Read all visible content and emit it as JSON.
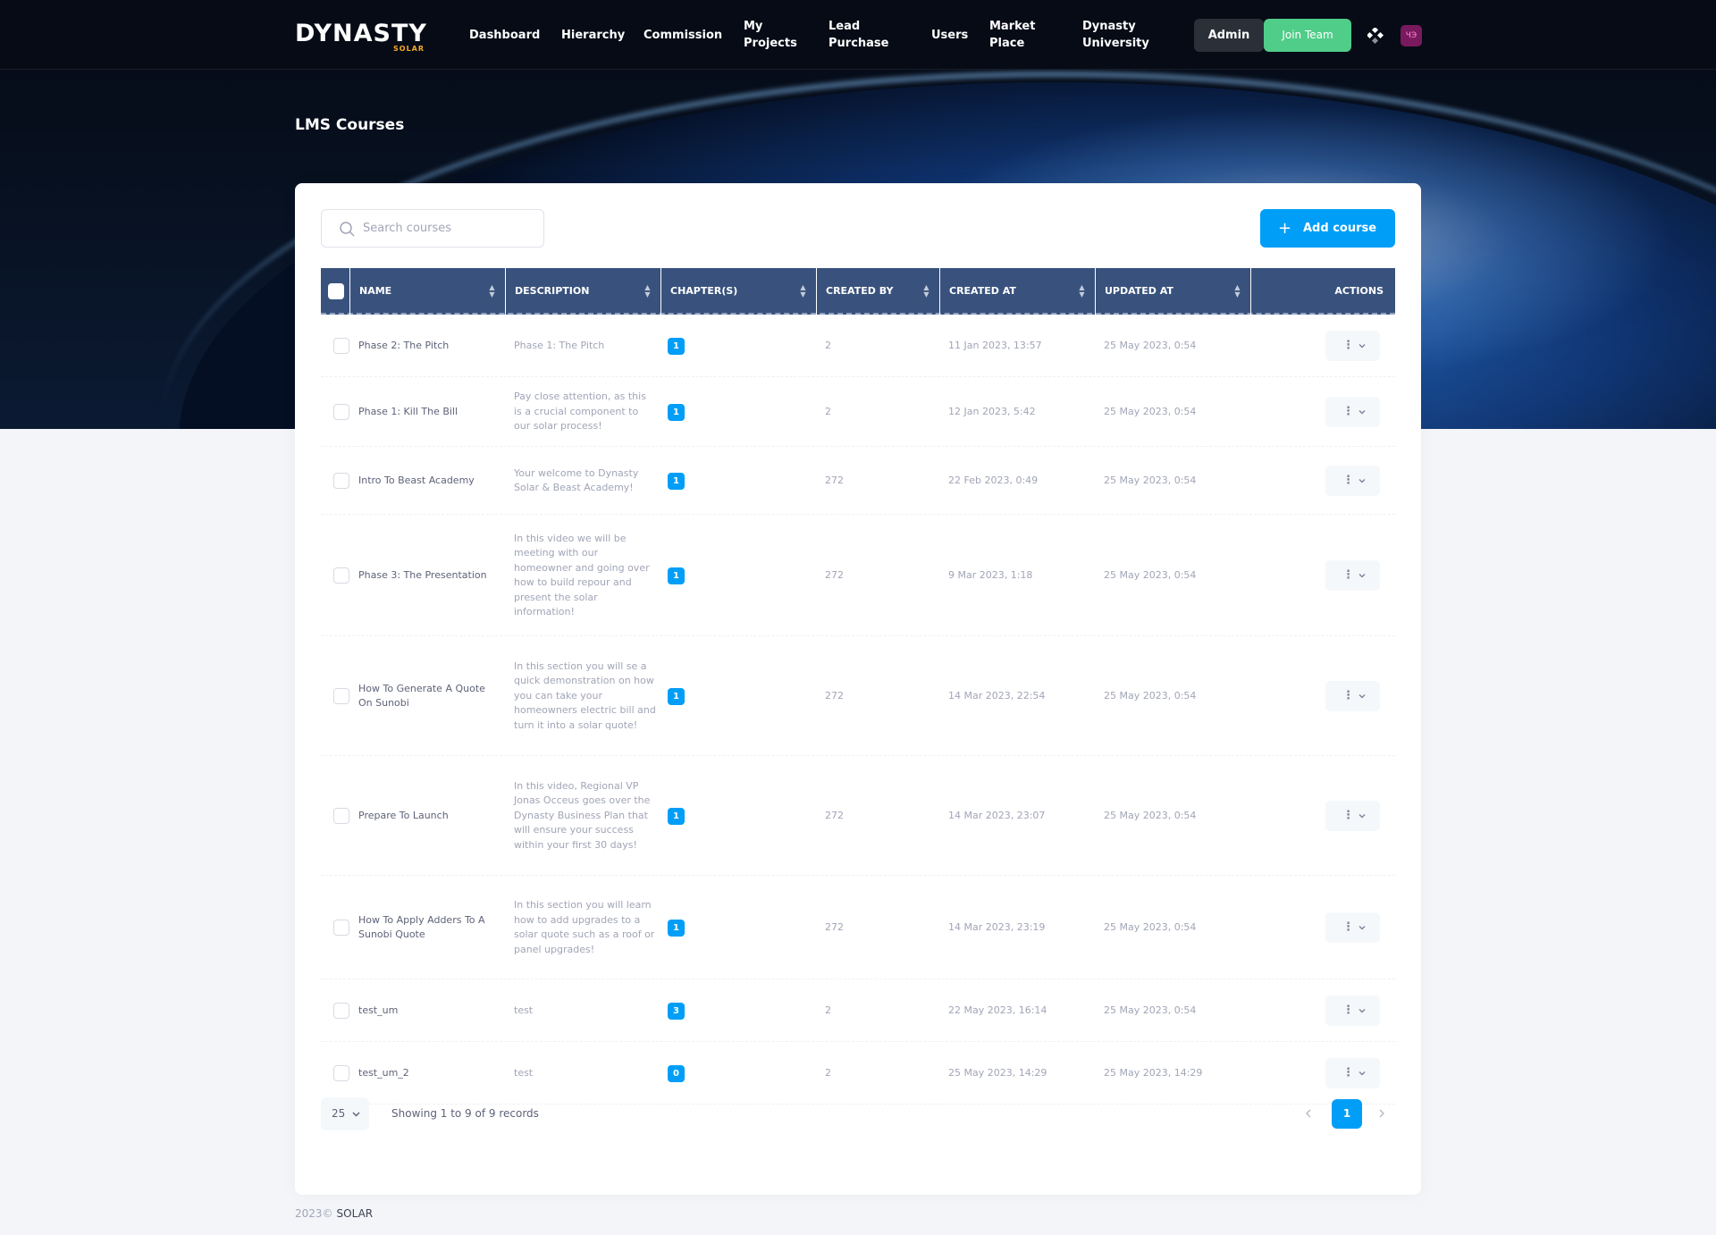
{
  "brand": {
    "logo_text": "DYNASTY",
    "logo_sub": "SOLAR"
  },
  "nav": [
    {
      "label": "Dashboard"
    },
    {
      "label": "Hierarchy"
    },
    {
      "label": "Commission"
    },
    {
      "label": "My Projects"
    },
    {
      "label": "Lead Purchase"
    },
    {
      "label": "Users"
    },
    {
      "label": "Market Place"
    },
    {
      "label": "Dynasty University"
    }
  ],
  "header": {
    "admin_label": "Admin",
    "join_label": "Join Team",
    "avatar_initials": "ЧЭ"
  },
  "page_title": "LMS Courses",
  "search": {
    "placeholder": "Search courses",
    "value": ""
  },
  "add_button": "Add course",
  "table": {
    "columns": [
      "NAME",
      "DESCRIPTION",
      "CHAPTER(S)",
      "CREATED BY",
      "CREATED AT",
      "UPDATED AT",
      "ACTIONS"
    ],
    "rows": [
      {
        "name": "Phase 2: The Pitch",
        "description": "Phase 1: The Pitch",
        "chapters": "1",
        "created_by": "2",
        "created_at": "11 Jan 2023, 13:57",
        "updated_at": "25 May 2023, 0:54"
      },
      {
        "name": "Phase 1: Kill The Bill",
        "description": "Pay close attention, as this is a crucial component to our solar process!",
        "chapters": "1",
        "created_by": "2",
        "created_at": "12 Jan 2023, 5:42",
        "updated_at": "25 May 2023, 0:54"
      },
      {
        "name": "Intro To Beast Academy",
        "description": "Your welcome to Dynasty Solar & Beast Academy!",
        "chapters": "1",
        "created_by": "272",
        "created_at": "22 Feb 2023, 0:49",
        "updated_at": "25 May 2023, 0:54"
      },
      {
        "name": "Phase 3: The Presentation",
        "description": "In this video we will be meeting with our homeowner and going over how to build repour and present the solar information!",
        "chapters": "1",
        "created_by": "272",
        "created_at": "9 Mar 2023, 1:18",
        "updated_at": "25 May 2023, 0:54"
      },
      {
        "name": "How To Generate A Quote On Sunobi",
        "description": "In this section you will se a quick demonstration on how you can take your homeowners electric bill and turn it into a solar quote!",
        "chapters": "1",
        "created_by": "272",
        "created_at": "14 Mar 2023, 22:54",
        "updated_at": "25 May 2023, 0:54"
      },
      {
        "name": "Prepare To Launch",
        "description": "In this video, Regional VP Jonas Occeus goes over the Dynasty Business Plan that will ensure your success within your first 30 days!",
        "chapters": "1",
        "created_by": "272",
        "created_at": "14 Mar 2023, 23:07",
        "updated_at": "25 May 2023, 0:54"
      },
      {
        "name": "How To Apply Adders To A Sunobi Quote",
        "description": "In this section you will learn how to add upgrades to a solar quote such as a roof or panel upgrades!",
        "chapters": "1",
        "created_by": "272",
        "created_at": "14 Mar 2023, 23:19",
        "updated_at": "25 May 2023, 0:54"
      },
      {
        "name": "test_um",
        "description": "test",
        "chapters": "3",
        "created_by": "2",
        "created_at": "22 May 2023, 16:14",
        "updated_at": "25 May 2023, 0:54"
      },
      {
        "name": "test_um_2",
        "description": "test",
        "chapters": "0",
        "created_by": "2",
        "created_at": "25 May 2023, 14:29",
        "updated_at": "25 May 2023, 14:29"
      }
    ]
  },
  "pagination": {
    "page_size": "25",
    "info": "Showing 1 to 9 of 9 records",
    "current_page": "1"
  },
  "footer": {
    "year": "2023©",
    "brand": "SOLAR"
  },
  "colors": {
    "primary": "#009ef7",
    "success": "#50cd89",
    "table_header": "#39527d",
    "nav_bg": "#060b16"
  },
  "icons": [
    "search-icon",
    "plus-icon",
    "sort-icon",
    "more-vertical-icon",
    "chevron-down-icon",
    "chevron-left-icon",
    "chevron-right-icon",
    "grid-icon"
  ]
}
